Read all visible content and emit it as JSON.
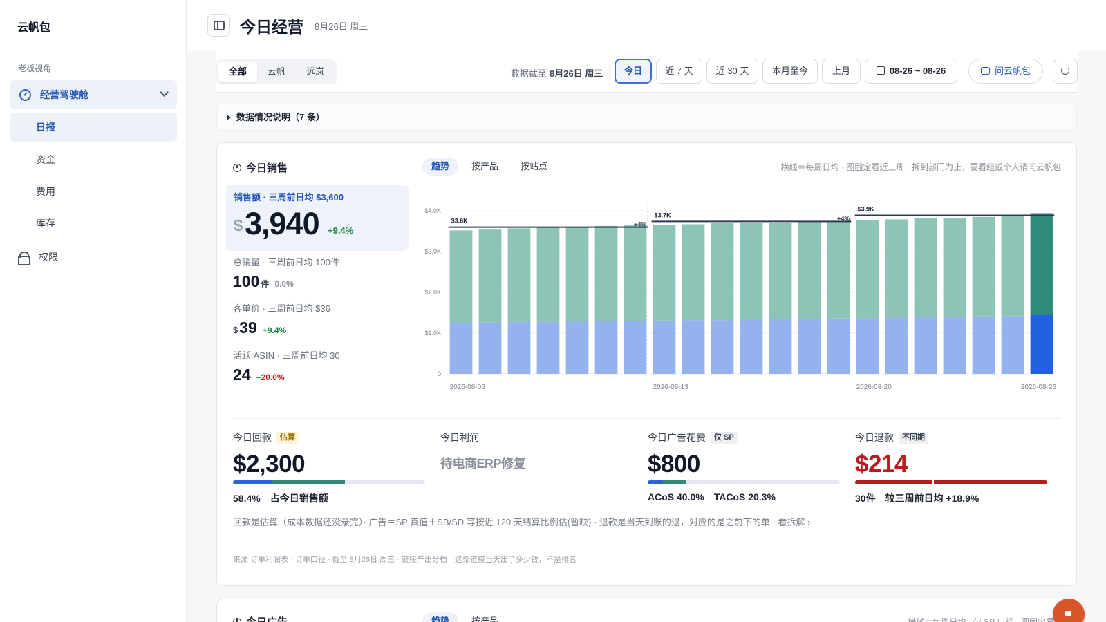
{
  "sidebar": {
    "brand": "云帆包",
    "section_label": "老板视角",
    "group_label": "经营驾驶舱",
    "items": [
      {
        "label": "日报"
      },
      {
        "label": "资金"
      },
      {
        "label": "费用"
      },
      {
        "label": "库存"
      }
    ],
    "permission_label": "权限"
  },
  "header": {
    "title": "今日经营",
    "date": "8月26日 周三"
  },
  "toolbar": {
    "segments": [
      "全部",
      "云帆",
      "远岚"
    ],
    "asof_prefix": "数据截至",
    "asof_date": "8月26日 周三",
    "ranges": [
      "今日",
      "近 7 天",
      "近 30 天",
      "本月至今",
      "上月"
    ],
    "date_range": "08-26 ~ 08-26",
    "ask_label": "问云帆包"
  },
  "notes": {
    "label": "数据情况说明（7 条）"
  },
  "sales_card": {
    "title": "今日销售",
    "tabs": [
      "趋势",
      "按产品",
      "按站点"
    ],
    "hint": "横线＝每周日均 · 图固定看近三周 · 拆到部门为止，要看组或个人请问云帆包",
    "primary": {
      "label": "销售额 · 三周前日均 $3,600",
      "currency": "$",
      "value": "3,940",
      "change": "+9.4%"
    },
    "kpis": [
      {
        "label": "总销量 · 三周前日均 100件",
        "currency": "",
        "value": "100",
        "unit": "件",
        "change": "0.0%",
        "color": "#8a909a"
      },
      {
        "label": "客单价 · 三周前日均 $36",
        "currency": "$",
        "value": "39",
        "unit": "",
        "change": "+9.4%",
        "color": "#14843d"
      },
      {
        "label": "活跃 ASIN · 三周前日均 30",
        "currency": "",
        "value": "24",
        "unit": "",
        "change": "−20.0%",
        "color": "#b91c1c"
      }
    ],
    "stats": [
      {
        "label": "今日回款",
        "badge": "估算",
        "value": "$2,300",
        "foot": [
          "58.4%",
          "占今日销售额"
        ]
      },
      {
        "label": "今日利润",
        "badge": "",
        "value": "待电商ERP修复",
        "foot": []
      },
      {
        "label": "今日广告花费",
        "badge": "仅 SP",
        "value": "$800",
        "foot": [
          "ACoS 40.0%",
          "TACoS 20.3%"
        ]
      },
      {
        "label": "今日退款",
        "badge": "不同期",
        "value": "$214",
        "foot": [
          "30件",
          "较三周前日均 +18.9%"
        ]
      }
    ],
    "note": "回款是估算（成本数据还没录完）· 广告＝SP 真值＋SB/SD 等按近 120 天结算比例估(暂缺) · 退款是当天到账的退，对应的是之前下的单 · 看拆解 ›",
    "source": "来源 订单利润表 · 订单口径 · 截至 8月26日 周三 · 链接产出分档＝这条链接当天出了多少钱，不是排名"
  },
  "ad_card": {
    "title": "今日广告",
    "tabs": [
      "趋势",
      "按产品"
    ],
    "hint": "横线＝每周日均 · 仅 SP 口径 · 图固定看近三"
  },
  "colors": {
    "accent": "#2457b7",
    "bar_top": "#8cc5b8",
    "bar_bottom": "#93b2ee",
    "bar_top_today": "#2e8b7a",
    "bar_bottom_today": "#2160de",
    "positive": "#14843d",
    "negative": "#b91c1c"
  },
  "chart_data": {
    "type": "bar",
    "stacked": true,
    "x_ticks": [
      "2026-08-06",
      "2026-08-13",
      "2026-08-20",
      "2026-08-26"
    ],
    "y_ticks": [
      "$4.0K",
      "$3.0K",
      "$2.0K",
      "$1.0K",
      "0"
    ],
    "ylim": [
      0,
      4000
    ],
    "categories": [
      "2026-08-06",
      "2026-08-07",
      "2026-08-08",
      "2026-08-09",
      "2026-08-10",
      "2026-08-11",
      "2026-08-12",
      "2026-08-13",
      "2026-08-14",
      "2026-08-15",
      "2026-08-16",
      "2026-08-17",
      "2026-08-18",
      "2026-08-19",
      "2026-08-20",
      "2026-08-21",
      "2026-08-22",
      "2026-08-23",
      "2026-08-24",
      "2026-08-25",
      "2026-08-26"
    ],
    "series": [
      {
        "values": [
          1250,
          1260,
          1270,
          1270,
          1280,
          1290,
          1300,
          1310,
          1320,
          1320,
          1330,
          1340,
          1350,
          1360,
          1370,
          1380,
          1390,
          1400,
          1410,
          1420,
          1450
        ]
      },
      {
        "values": [
          2270,
          2280,
          2300,
          2320,
          2330,
          2340,
          2350,
          2340,
          2350,
          2380,
          2380,
          2370,
          2390,
          2380,
          2410,
          2410,
          2430,
          2430,
          2440,
          2450,
          2490
        ]
      }
    ],
    "weekly_avg": [
      {
        "label": "$3.6K",
        "value": 3600,
        "change": "+4%",
        "start": 0,
        "end": 6
      },
      {
        "label": "$3.7K",
        "value": 3740,
        "change": "+4%",
        "start": 7,
        "end": 13
      },
      {
        "label": "$3.9K",
        "value": 3890,
        "change": "",
        "start": 14,
        "end": 20
      }
    ]
  }
}
